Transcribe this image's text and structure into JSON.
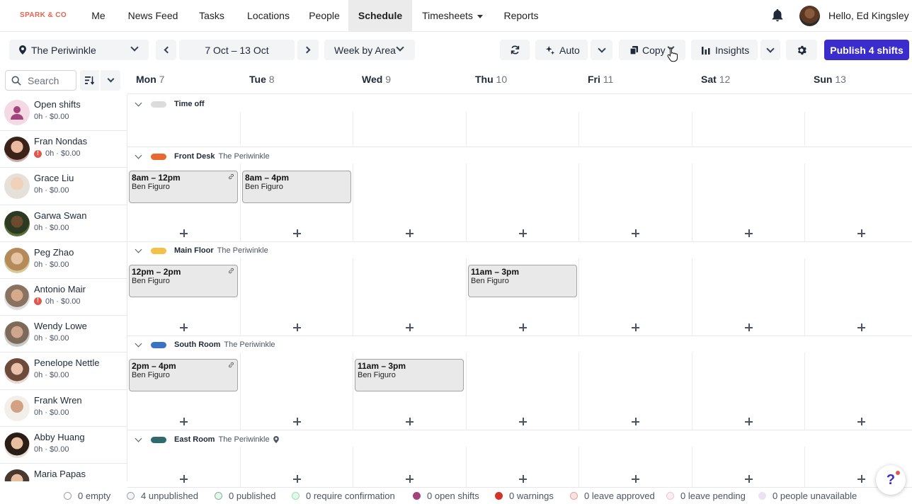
{
  "brand": "SPARK & CO",
  "nav": {
    "me": "Me",
    "news_feed": "News Feed",
    "tasks": "Tasks",
    "locations": "Locations",
    "people": "People",
    "schedule": "Schedule",
    "timesheets": "Timesheets",
    "reports": "Reports",
    "greeting": "Hello, Ed Kingsley"
  },
  "toolbar": {
    "location": "The Periwinkle",
    "date_range": "7 Oct – 13 Oct",
    "view": "Week by Area",
    "auto": "Auto",
    "copy": "Copy",
    "insights": "Insights",
    "publish": "Publish 4 shifts"
  },
  "search": {
    "placeholder": "Search"
  },
  "days": [
    {
      "name": "Mon",
      "num": "7"
    },
    {
      "name": "Tue",
      "num": "8"
    },
    {
      "name": "Wed",
      "num": "9"
    },
    {
      "name": "Thu",
      "num": "10"
    },
    {
      "name": "Fri",
      "num": "11"
    },
    {
      "name": "Sat",
      "num": "12"
    },
    {
      "name": "Sun",
      "num": "13"
    }
  ],
  "people": [
    {
      "name": "Open shifts",
      "meta": "0h · $0.00",
      "warn": false
    },
    {
      "name": "Fran Nondas",
      "meta": "0h · $0.00",
      "warn": true
    },
    {
      "name": "Grace Liu",
      "meta": "0h · $0.00",
      "warn": false
    },
    {
      "name": "Garwa Swan",
      "meta": "0h · $0.00",
      "warn": false
    },
    {
      "name": "Peg Zhao",
      "meta": "0h · $0.00",
      "warn": false
    },
    {
      "name": "Antonio Mair",
      "meta": "0h · $0.00",
      "warn": true
    },
    {
      "name": "Wendy Lowe",
      "meta": "0h · $0.00",
      "warn": false
    },
    {
      "name": "Penelope Nettle",
      "meta": "0h · $0.00",
      "warn": false
    },
    {
      "name": "Frank Wren",
      "meta": "0h · $0.00",
      "warn": false
    },
    {
      "name": "Abby Huang",
      "meta": "0h · $0.00",
      "warn": false
    },
    {
      "name": "Maria Papas",
      "meta": "",
      "warn": false
    }
  ],
  "areas": [
    {
      "name": "Time off",
      "location": "",
      "color": "#dcdcdc"
    },
    {
      "name": "Front Desk",
      "location": "The Periwinkle",
      "color": "#e8692f"
    },
    {
      "name": "Main Floor",
      "location": "The Periwinkle",
      "color": "#f5c04a"
    },
    {
      "name": "South Room",
      "location": "The Periwinkle",
      "color": "#3a73c4"
    },
    {
      "name": "East Room",
      "location": "The Periwinkle",
      "color": "#2f6b6e"
    }
  ],
  "shifts": {
    "fd_mon": {
      "time": "8am – 12pm",
      "person": "Ben Figuro"
    },
    "fd_tue": {
      "time": "8am – 4pm",
      "person": "Ben Figuro"
    },
    "mf_mon": {
      "time": "12pm – 2pm",
      "person": "Ben Figuro"
    },
    "mf_thu": {
      "time": "11am – 3pm",
      "person": "Ben Figuro"
    },
    "sr_mon": {
      "time": "2pm – 4pm",
      "person": "Ben Figuro"
    },
    "sr_wed": {
      "time": "11am – 3pm",
      "person": "Ben Figuro"
    }
  },
  "legend": [
    {
      "label": "0 empty",
      "fill": "#ffffff",
      "border": "#9ca3af"
    },
    {
      "label": "4 unpublished",
      "fill": "#f3f4f6",
      "border": "#9ca3af"
    },
    {
      "label": "0 published",
      "fill": "#dcfce7",
      "border": "#9ca3af"
    },
    {
      "label": "0 require confirmation",
      "fill": "#dcfce7",
      "border": "#a7d7b4"
    },
    {
      "label": "0 open shifts",
      "fill": "#a3437e",
      "border": "#a3437e"
    },
    {
      "label": "0 warnings",
      "fill": "#d4332b",
      "border": "#d4332b"
    },
    {
      "label": "0 leave approved",
      "fill": "#fde2e2",
      "border": "#e8a0a0"
    },
    {
      "label": "0 leave pending",
      "fill": "#fdeef3",
      "border": "#f3c4d4"
    },
    {
      "label": "0 people unavailable",
      "fill": "#e9e3f3",
      "border": "#e9e3f3"
    }
  ],
  "colors": {
    "accent": "#3b2ccc",
    "brand": "#e8624c"
  }
}
